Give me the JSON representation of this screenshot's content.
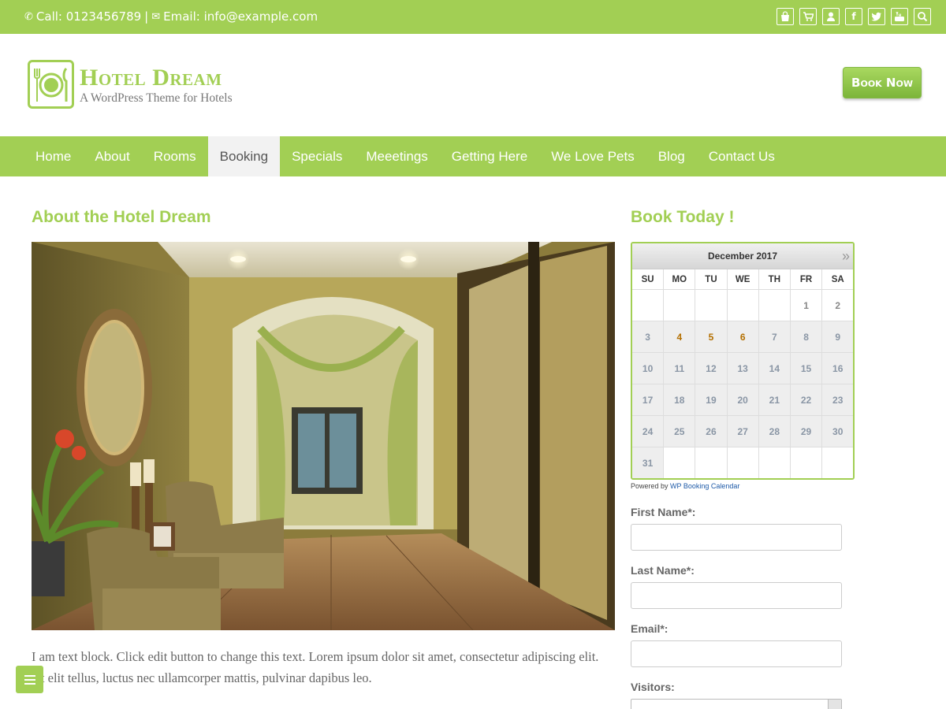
{
  "topbar": {
    "phone_text": "Call: 0123456789",
    "separator": "|",
    "email_text": "Email: info@example.com",
    "icons": [
      "shopping-bag-icon",
      "cart-icon",
      "user-icon",
      "facebook-icon",
      "twitter-icon",
      "youtube-icon",
      "search-icon"
    ]
  },
  "header": {
    "site_title": "Hotel Dream",
    "tagline": "A WordPress Theme for Hotels",
    "book_now_label": "Book Now"
  },
  "nav": {
    "items": [
      {
        "label": "Home"
      },
      {
        "label": "About"
      },
      {
        "label": "Rooms"
      },
      {
        "label": "Booking"
      },
      {
        "label": "Specials"
      },
      {
        "label": "Meeetings"
      },
      {
        "label": "Getting Here"
      },
      {
        "label": "We Love Pets"
      },
      {
        "label": "Blog"
      },
      {
        "label": "Contact Us"
      }
    ],
    "active": "Booking"
  },
  "main": {
    "title": "About the Hotel Dream",
    "body_text": "I am text block. Click edit button to change this text. Lorem ipsum dolor sit amet, consectetur adipiscing elit. Ut elit tellus, luctus nec ullamcorper mattis, pulvinar dapibus leo."
  },
  "sidebar": {
    "title": "Book Today !",
    "calendar": {
      "month_label": "December 2017",
      "next_symbol": "»",
      "weekdays": [
        "SU",
        "MO",
        "TU",
        "WE",
        "TH",
        "FR",
        "SA"
      ],
      "cells": [
        "",
        "",
        "",
        "",
        "",
        "1",
        "2",
        "3",
        "4",
        "5",
        "6",
        "7",
        "8",
        "9",
        "10",
        "11",
        "12",
        "13",
        "14",
        "15",
        "16",
        "17",
        "18",
        "19",
        "20",
        "21",
        "22",
        "23",
        "24",
        "25",
        "26",
        "27",
        "28",
        "29",
        "30",
        "31",
        "",
        "",
        "",
        "",
        "",
        ""
      ],
      "highlighted_days": [
        "4",
        "5",
        "6"
      ],
      "highlight_color": "#b46f00"
    },
    "powered_by_prefix": "Powered by",
    "powered_by_link": "WP Booking Calendar",
    "form": {
      "first_name_label": "First Name*:",
      "last_name_label": "Last Name*:",
      "email_label": "Email*:",
      "visitors_label": "Visitors:"
    }
  },
  "colors": {
    "accent": "#a2cf54",
    "text": "#666666"
  }
}
